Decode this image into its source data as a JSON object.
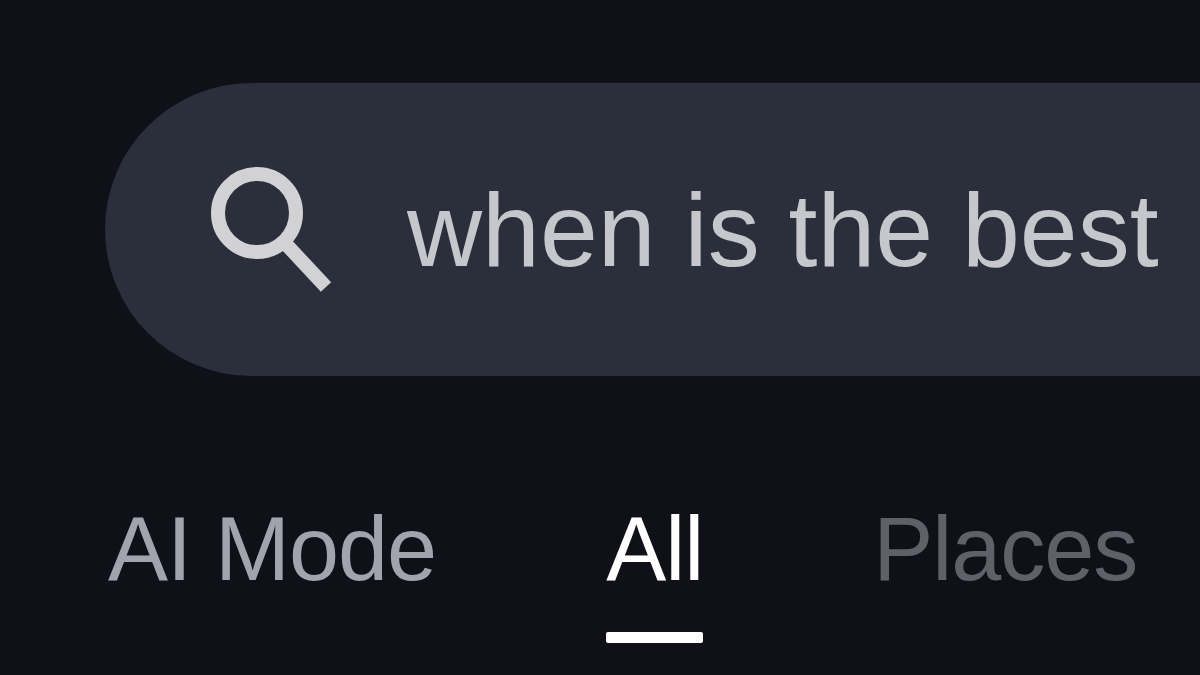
{
  "search": {
    "value": "when is the best"
  },
  "tabs": [
    {
      "label": "AI Mode",
      "selected": false
    },
    {
      "label": "All",
      "selected": true
    },
    {
      "label": "Places",
      "selected": false
    }
  ]
}
